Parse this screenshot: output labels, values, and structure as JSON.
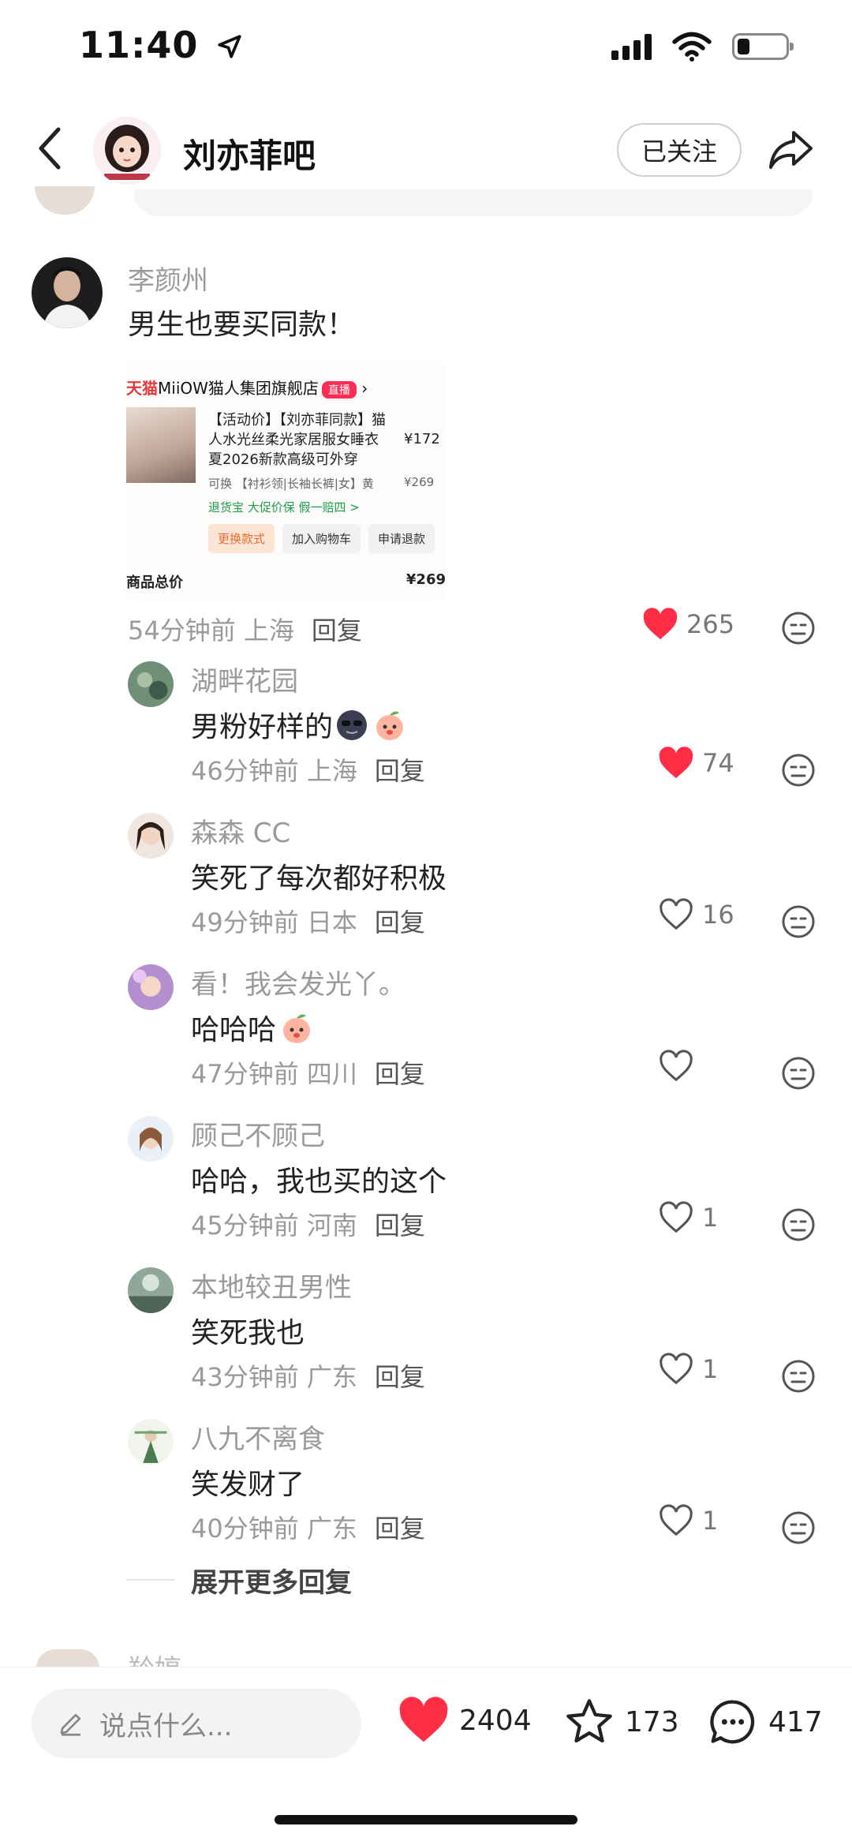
{
  "status_bar": {
    "time": "11:40",
    "battery_level": 0.25
  },
  "header": {
    "title": "刘亦菲吧",
    "follow_label": "已关注"
  },
  "main_comment": {
    "author": "李颜州",
    "text": "男生也要买同款！",
    "time": "54分钟前",
    "location": "上海",
    "reply_label": "回复",
    "likes": "265",
    "liked": true
  },
  "product_card": {
    "store_brand": "天猫",
    "store_name": "MiiOW猫人集团旗舰店",
    "live_badge": "直播",
    "title": "【活动价】【刘亦菲同款】猫人水光丝柔光家居服女睡衣夏2026新款高级可外穿",
    "price": "¥172",
    "spec_tag": "可换",
    "spec": "【衬衫领|长袖长裤|女】黄",
    "spec_price": "¥269",
    "services": "退货宝  大促价保  假一赔四 >",
    "button_change": "更换款式",
    "button_cart": "加入购物车",
    "button_refund": "申请退款",
    "total_label": "商品总价",
    "total_price": "¥269"
  },
  "replies": [
    {
      "author": "湖畔花园",
      "text": "男粉好样的",
      "time": "46分钟前",
      "location": "上海",
      "reply_label": "回复",
      "likes": "74",
      "liked": true
    },
    {
      "author": "森森 CC",
      "text": "笑死了每次都好积极",
      "time": "49分钟前",
      "location": "日本",
      "reply_label": "回复",
      "likes": "16",
      "liked": false
    },
    {
      "author": "看！我会发光丫。",
      "text": "哈哈哈",
      "time": "47分钟前",
      "location": "四川",
      "reply_label": "回复",
      "likes": "",
      "liked": false
    },
    {
      "author": "顾己不顾己",
      "text": "哈哈，我也买的这个",
      "time": "45分钟前",
      "location": "河南",
      "reply_label": "回复",
      "likes": "1",
      "liked": false
    },
    {
      "author": "本地较丑男性",
      "text": "笑死我也",
      "time": "43分钟前",
      "location": "广东",
      "reply_label": "回复",
      "likes": "1",
      "liked": false
    },
    {
      "author": "八九不离食",
      "text": "笑发财了",
      "time": "40分钟前",
      "location": "广东",
      "reply_label": "回复",
      "likes": "1",
      "liked": false
    }
  ],
  "expand_label": "展开更多回复",
  "next_comment_author": "羚婷",
  "bottom_bar": {
    "input_placeholder": "说点什么...",
    "likes": "2404",
    "stars": "173",
    "comments": "417"
  },
  "colors": {
    "like_red": "#ff2d46",
    "text_gray": "#9a9a9a",
    "green_service": "#1a9e4a"
  }
}
